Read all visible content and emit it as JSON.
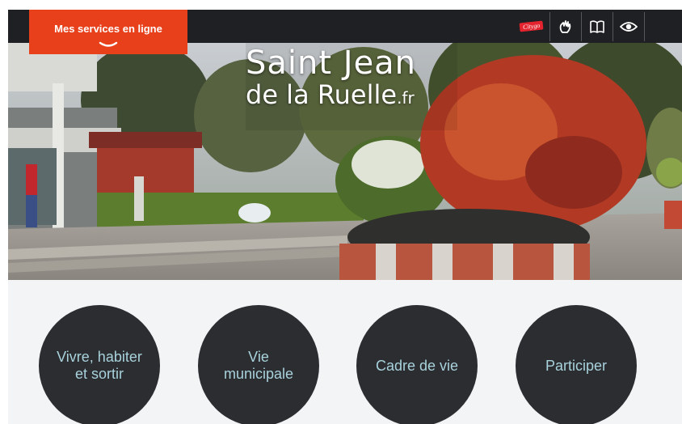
{
  "header": {
    "services_button": "Mes services en ligne",
    "tools": [
      {
        "name": "citygo-logo",
        "label": "Citygo"
      },
      {
        "name": "sign-language-icon"
      },
      {
        "name": "book-icon"
      },
      {
        "name": "eye-icon"
      }
    ]
  },
  "hero": {
    "title_line1": "Saint Jean",
    "title_line2": "de la Ruelle",
    "title_tld": ".fr"
  },
  "cards": [
    {
      "label": "Vivre, habiter et sortir"
    },
    {
      "label": "Vie municipale"
    },
    {
      "label": "Cadre de vie"
    },
    {
      "label": "Participer"
    }
  ],
  "colors": {
    "top_bar": "#1f2023",
    "accent": "#e8401b",
    "card_bg": "#2c2d31",
    "card_text": "#a8d2dc",
    "page_bg": "#f3f4f6"
  }
}
